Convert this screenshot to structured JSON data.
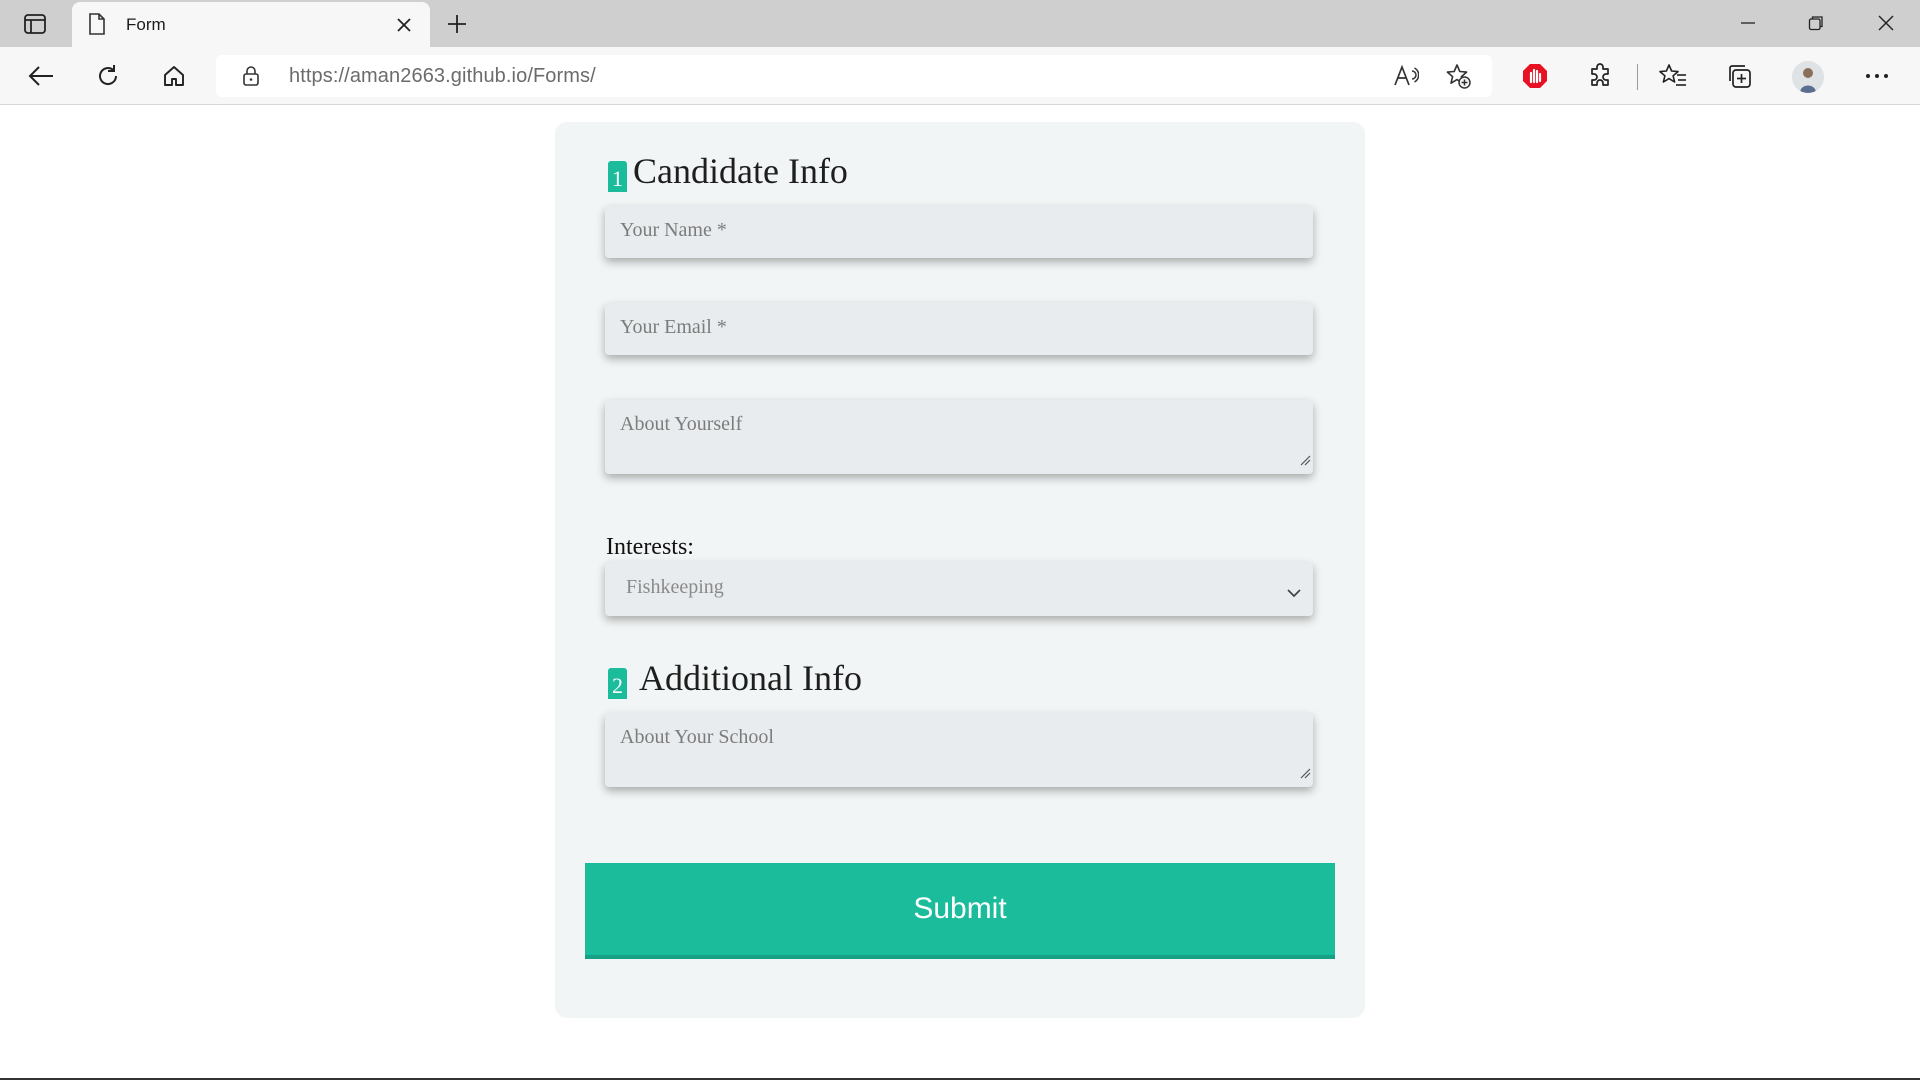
{
  "browser": {
    "tab": {
      "title": "Form"
    },
    "address": {
      "url_host": "https://aman2663.github.io",
      "url_path": "/Forms/"
    },
    "colors": {
      "tabbar": "#cfcfcf",
      "toolbar": "#f7f7f7",
      "adblock_red": "#e81123"
    }
  },
  "form": {
    "section1": {
      "number": "1",
      "title": "Candidate Info"
    },
    "name": {
      "placeholder": "Your Name *"
    },
    "email": {
      "placeholder": "Your Email *"
    },
    "about": {
      "placeholder": "About Yourself"
    },
    "interests": {
      "label": "Interests:",
      "selected": "Fishkeeping"
    },
    "section2": {
      "number": "2",
      "title": "Additional Info"
    },
    "school": {
      "placeholder": "About Your School"
    },
    "submit_label": "Submit",
    "colors": {
      "accent": "#1abc9c",
      "card": "#f2f5f5",
      "field": "#e8ecee"
    }
  }
}
